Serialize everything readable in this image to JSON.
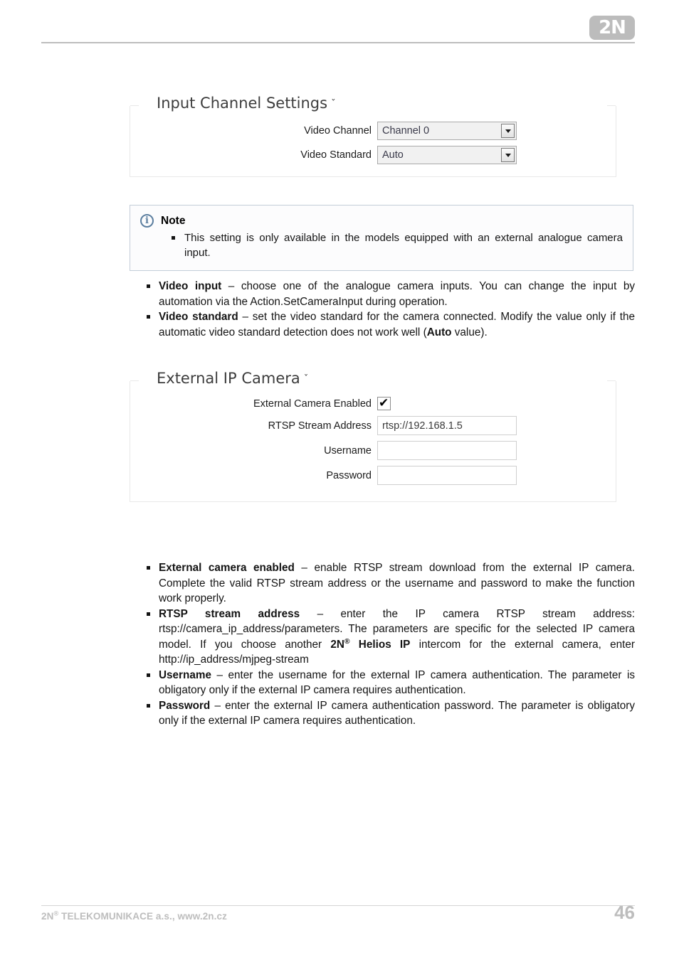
{
  "header": {
    "logo_text": "2N"
  },
  "panels": [
    {
      "title": "Input Channel Settings",
      "chevron": "ˇ",
      "fields": [
        {
          "label": "Video Channel",
          "type": "select",
          "value": "Channel 0"
        },
        {
          "label": "Video Standard",
          "type": "select",
          "value": "Auto"
        }
      ]
    },
    {
      "title": "External IP Camera",
      "chevron": "ˇ",
      "fields": [
        {
          "label": "External Camera Enabled",
          "type": "checkbox",
          "value": "checked",
          "tick": "✔"
        },
        {
          "label": "RTSP Stream Address",
          "type": "text",
          "value": "rtsp://192.168.1.5"
        },
        {
          "label": "Username",
          "type": "text",
          "value": ""
        },
        {
          "label": "Password",
          "type": "text",
          "value": ""
        }
      ]
    }
  ],
  "note": {
    "icon": "info-icon",
    "icon_glyph": "i",
    "title": "Note",
    "items": [
      "This setting is only available in the models equipped with an external analogue camera input."
    ]
  },
  "list_one": [
    {
      "term": "Video input",
      "text": " – choose one of the analogue camera inputs. You can change the input by automation via the Action.SetCameraInput during operation."
    },
    {
      "term": "Video standard",
      "text_before": " – set the video standard for the camera connected. Modify the value only if the automatic video standard detection does not work well (",
      "emphasis": "Auto",
      "text_after": " value)."
    }
  ],
  "list_two": [
    {
      "term": "External camera enabled",
      "text": " – enable RTSP stream download from the external IP camera. Complete the valid RTSP stream address or the username and password to make the function work properly."
    },
    {
      "term": "RTSP stream address",
      "text_before": " – enter the IP camera RTSP stream address: rtsp://camera_ip_address/parameters. The parameters are specific for the selected IP camera model. If you choose another ",
      "emphasis": "2N",
      "emphasis_sup": "®",
      "emphasis_two": " Helios IP",
      "text_after": " intercom for the external camera, enter http://ip_address/mjpeg-stream"
    },
    {
      "term": "Username",
      "text": " – enter the username for the external IP camera authentication. The parameter is obligatory only if the external IP camera requires authentication."
    },
    {
      "term": "Password",
      "text": " – enter the external IP camera authentication password. The parameter is obligatory only if the external IP camera requires authentication."
    }
  ],
  "footer": {
    "company": "2N",
    "company_sup": "®",
    "company_rest": " TELEKOMUNIKACE a.s., www.2n.cz",
    "page_number": "46"
  },
  "colors": {
    "brand_grey": "#bcbcbc",
    "note_border": "#c3cdd8",
    "note_icon": "#5b7e9f",
    "panel_border": "#e8e8e8"
  }
}
